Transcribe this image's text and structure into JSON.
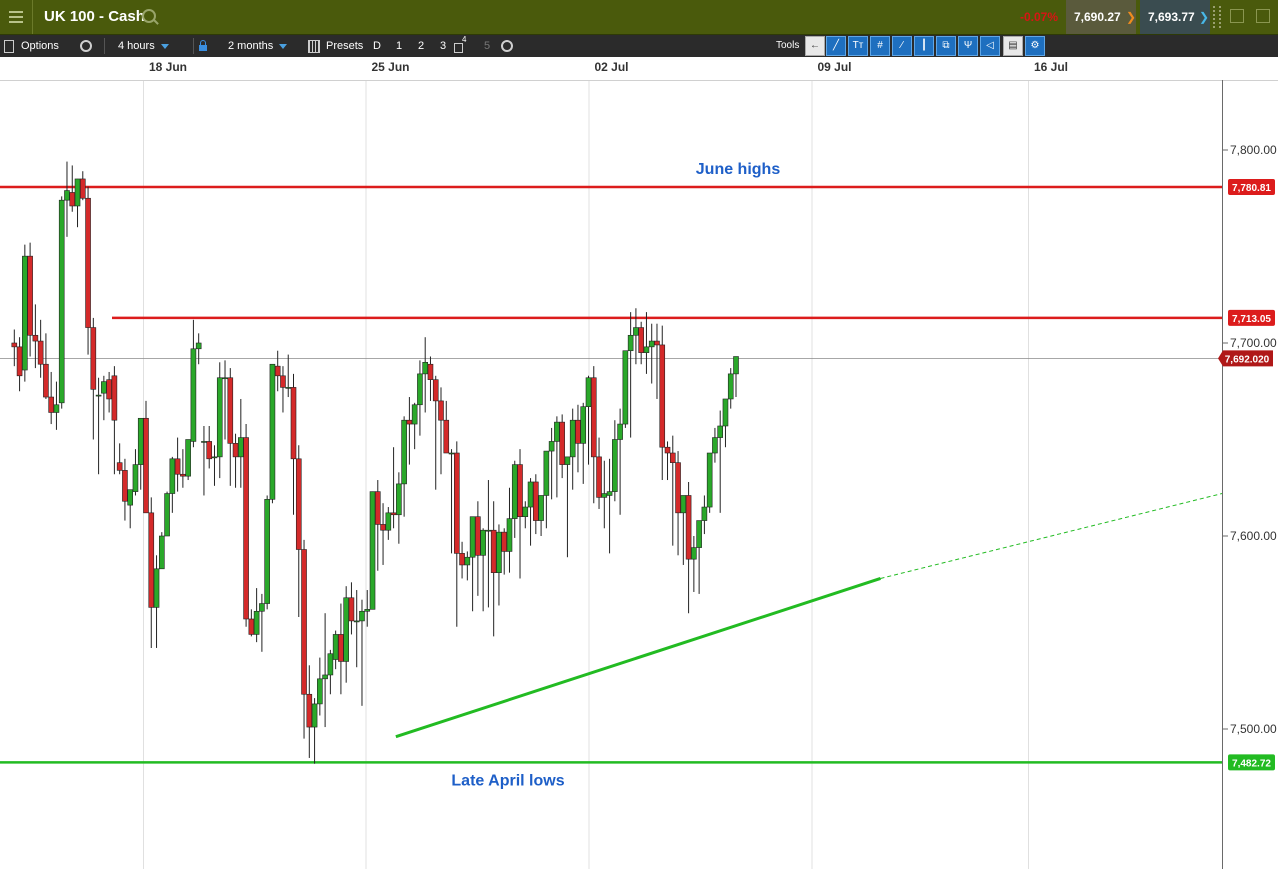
{
  "header": {
    "title": "UK 100 - Cash",
    "change": "-0.07%",
    "sell_price": "7,690.27",
    "buy_price": "7,693.77"
  },
  "toolbar": {
    "options_label": "Options",
    "timeframe": "4 hours",
    "range": "2 months",
    "presets_label": "Presets",
    "presets": [
      "D",
      "1",
      "2",
      "3",
      "4",
      "5"
    ],
    "tools_label": "Tools",
    "tool_icons": [
      "back-arrow-icon",
      "curve-line-icon",
      "text-tool-icon",
      "channel-icon",
      "fibonacci-icon",
      "candle-icon",
      "layers-icon",
      "pitchfork-icon",
      "shape-icon",
      "print-icon",
      "settings-tool-icon"
    ]
  },
  "colors": {
    "up_candle": "#2aa82a",
    "down_candle": "#d42a2a",
    "resistance": "#dc1c1c",
    "support": "#22bb22",
    "annotation": "#1e5fc8"
  },
  "chart_data": {
    "type": "candlestick",
    "instrument": "UK 100 - Cash",
    "timeframe": "4 hours",
    "x_tick_labels": [
      "18 Jun",
      "25 Jun",
      "02 Jul",
      "09 Jul",
      "16 Jul"
    ],
    "y_tick_labels": [
      "7,800.00",
      "7,700.00",
      "7,600.00",
      "7,500.00"
    ],
    "y_ticks": [
      7800,
      7700,
      7600,
      7500
    ],
    "ylim": [
      7428,
      7835
    ],
    "grid": true,
    "current_price": 7692.02,
    "current_price_label": "7,692.020",
    "horizontal_lines": [
      {
        "value": 7780.81,
        "label": "7,780.81",
        "color": "#dc1c1c",
        "annotation": "June highs"
      },
      {
        "value": 7713.05,
        "label": "7,713.05",
        "color": "#dc1c1c",
        "annotation": ""
      },
      {
        "value": 7482.72,
        "label": "7,482.72",
        "color": "#22bb22",
        "annotation": "Late April lows"
      }
    ],
    "trendline": {
      "from": {
        "date": "26 Jun",
        "value": 7496
      },
      "to": {
        "date": "11 Jul",
        "value": 7578
      },
      "extension_to": {
        "date": "17 Jul",
        "value": 7622
      },
      "color": "#22bb22"
    },
    "candles": [
      [
        7700,
        7707,
        7688,
        7698
      ],
      [
        7698,
        7703,
        7675,
        7683
      ],
      [
        7686,
        7751,
        7680,
        7745
      ],
      [
        7745,
        7752,
        7693,
        7704
      ],
      [
        7704,
        7720,
        7687,
        7701
      ],
      [
        7701,
        7712,
        7682,
        7689
      ],
      [
        7689,
        7705,
        7671,
        7672
      ],
      [
        7672,
        7685,
        7658,
        7664
      ],
      [
        7664,
        7680,
        7655,
        7668
      ],
      [
        7669,
        7776,
        7666,
        7774
      ],
      [
        7774,
        7794,
        7755,
        7779
      ],
      [
        7778,
        7792,
        7768,
        7771
      ],
      [
        7771,
        7785,
        7760,
        7785
      ],
      [
        7785,
        7789,
        7774,
        7775
      ],
      [
        7775,
        7781,
        7694,
        7708
      ],
      [
        7708,
        7713,
        7650,
        7676
      ],
      [
        7673,
        7682,
        7632,
        7673
      ],
      [
        7674,
        7683,
        7660,
        7680
      ],
      [
        7681,
        7685,
        7664,
        7671
      ],
      [
        7683,
        7688,
        7632,
        7660
      ],
      [
        7638,
        7648,
        7632,
        7634
      ],
      [
        7634,
        7640,
        7608,
        7618
      ],
      [
        7616,
        7624,
        7604,
        7624
      ],
      [
        7623,
        7645,
        7621,
        7637
      ],
      [
        7637,
        7661,
        7624,
        7661
      ],
      [
        7661,
        7670,
        7612,
        7612
      ],
      [
        7612,
        7620,
        7542,
        7563
      ],
      [
        7563,
        7590,
        7542,
        7583
      ],
      [
        7583,
        7602,
        7588,
        7600
      ],
      [
        7600,
        7623,
        7600,
        7622
      ],
      [
        7622,
        7641,
        7612,
        7640
      ],
      [
        7640,
        7651,
        7623,
        7632
      ],
      [
        7632,
        7645,
        7625,
        7631
      ],
      [
        7631,
        7647,
        7629,
        7650
      ],
      [
        7649,
        7712,
        7646,
        7697
      ],
      [
        7697,
        7705,
        7689,
        7700
      ],
      [
        7649,
        7657,
        7621,
        7649
      ],
      [
        7649,
        7657,
        7635,
        7640
      ],
      [
        7641,
        7647,
        7626,
        7641
      ],
      [
        7641,
        7690,
        7630,
        7682
      ],
      [
        7682,
        7691,
        7650,
        7682
      ],
      [
        7682,
        7687,
        7626,
        7648
      ],
      [
        7648,
        7653,
        7625,
        7641
      ],
      [
        7641,
        7671,
        7625,
        7651
      ],
      [
        7651,
        7658,
        7553,
        7557
      ],
      [
        7557,
        7562,
        7548,
        7549
      ],
      [
        7549,
        7573,
        7545,
        7561
      ],
      [
        7561,
        7570,
        7540,
        7565
      ],
      [
        7565,
        7621,
        7562,
        7619
      ],
      [
        7619,
        7689,
        7617,
        7689
      ],
      [
        7688,
        7696,
        7675,
        7683
      ],
      [
        7683,
        7688,
        7664,
        7677
      ],
      [
        7677,
        7694,
        7672,
        7677
      ],
      [
        7677,
        7684,
        7611,
        7640
      ],
      [
        7640,
        7647,
        7558,
        7593
      ],
      [
        7593,
        7598,
        7495,
        7518
      ],
      [
        7518,
        7533,
        7485,
        7501
      ],
      [
        7501,
        7516,
        7482,
        7513
      ],
      [
        7513,
        7537,
        7507,
        7526
      ],
      [
        7526,
        7560,
        7501,
        7528
      ],
      [
        7528,
        7541,
        7518,
        7539
      ],
      [
        7536,
        7551,
        7531,
        7549
      ],
      [
        7549,
        7565,
        7518,
        7535
      ],
      [
        7535,
        7574,
        7524,
        7568
      ],
      [
        7568,
        7576,
        7549,
        7556
      ],
      [
        7556,
        7572,
        7532,
        7556
      ],
      [
        7556,
        7567,
        7512,
        7561
      ],
      [
        7561,
        7572,
        7553,
        7562
      ],
      [
        7562,
        7623,
        7562,
        7623
      ],
      [
        7623,
        7629,
        7582,
        7606
      ],
      [
        7606,
        7617,
        7585,
        7603
      ],
      [
        7603,
        7615,
        7598,
        7612
      ],
      [
        7612,
        7646,
        7604,
        7611
      ],
      [
        7611,
        7633,
        7596,
        7627
      ],
      [
        7627,
        7662,
        7610,
        7660
      ],
      [
        7660,
        7672,
        7637,
        7658
      ],
      [
        7658,
        7669,
        7645,
        7668
      ],
      [
        7668,
        7691,
        7652,
        7684
      ],
      [
        7684,
        7703,
        7664,
        7690
      ],
      [
        7689,
        7693,
        7670,
        7681
      ],
      [
        7681,
        7683,
        7624,
        7670
      ],
      [
        7670,
        7677,
        7632,
        7660
      ],
      [
        7660,
        7670,
        7646,
        7643
      ],
      [
        7643,
        7645,
        7591,
        7643
      ],
      [
        7643,
        7649,
        7553,
        7591
      ],
      [
        7591,
        7597,
        7578,
        7585
      ],
      [
        7585,
        7592,
        7577,
        7589
      ],
      [
        7589,
        7600,
        7561,
        7610
      ],
      [
        7610,
        7618,
        7569,
        7590
      ],
      [
        7590,
        7604,
        7561,
        7603
      ],
      [
        7603,
        7629,
        7563,
        7603
      ],
      [
        7603,
        7618,
        7548,
        7581
      ],
      [
        7581,
        7606,
        7564,
        7602
      ],
      [
        7602,
        7604,
        7580,
        7592
      ],
      [
        7592,
        7625,
        7581,
        7609
      ],
      [
        7609,
        7639,
        7599,
        7637
      ],
      [
        7637,
        7645,
        7578,
        7610
      ],
      [
        7610,
        7618,
        7604,
        7615
      ],
      [
        7615,
        7630,
        7595,
        7628
      ],
      [
        7628,
        7632,
        7601,
        7608
      ],
      [
        7608,
        7621,
        7600,
        7621
      ],
      [
        7621,
        7644,
        7604,
        7644
      ],
      [
        7644,
        7656,
        7619,
        7649
      ],
      [
        7649,
        7662,
        7620,
        7659
      ],
      [
        7659,
        7663,
        7630,
        7637
      ],
      [
        7637,
        7641,
        7589,
        7641
      ],
      [
        7641,
        7666,
        7624,
        7660
      ],
      [
        7660,
        7668,
        7633,
        7648
      ],
      [
        7648,
        7669,
        7627,
        7667
      ],
      [
        7667,
        7683,
        7637,
        7682
      ],
      [
        7682,
        7688,
        7617,
        7641
      ],
      [
        7641,
        7651,
        7614,
        7620
      ],
      [
        7620,
        7639,
        7604,
        7622
      ],
      [
        7621,
        7640,
        7591,
        7623
      ],
      [
        7623,
        7660,
        7618,
        7650
      ],
      [
        7650,
        7666,
        7611,
        7658
      ],
      [
        7658,
        7696,
        7656,
        7696
      ],
      [
        7696,
        7716,
        7651,
        7704
      ],
      [
        7704,
        7718,
        7689,
        7708
      ],
      [
        7708,
        7711,
        7689,
        7695
      ],
      [
        7695,
        7716,
        7684,
        7698
      ],
      [
        7698,
        7710,
        7679,
        7701
      ],
      [
        7701,
        7710,
        7671,
        7699
      ],
      [
        7699,
        7709,
        7629,
        7646
      ],
      [
        7646,
        7649,
        7629,
        7643
      ],
      [
        7643,
        7652,
        7595,
        7638
      ],
      [
        7638,
        7644,
        7590,
        7612
      ],
      [
        7612,
        7619,
        7585,
        7621
      ],
      [
        7621,
        7628,
        7560,
        7588
      ],
      [
        7588,
        7600,
        7571,
        7594
      ],
      [
        7594,
        7607,
        7570,
        7608
      ],
      [
        7608,
        7621,
        7601,
        7615
      ],
      [
        7615,
        7641,
        7612,
        7643
      ],
      [
        7643,
        7656,
        7638,
        7651
      ],
      [
        7651,
        7665,
        7612,
        7657
      ],
      [
        7657,
        7664,
        7646,
        7671
      ],
      [
        7671,
        7687,
        7666,
        7684
      ],
      [
        7684,
        7693,
        7672,
        7693
      ]
    ]
  }
}
